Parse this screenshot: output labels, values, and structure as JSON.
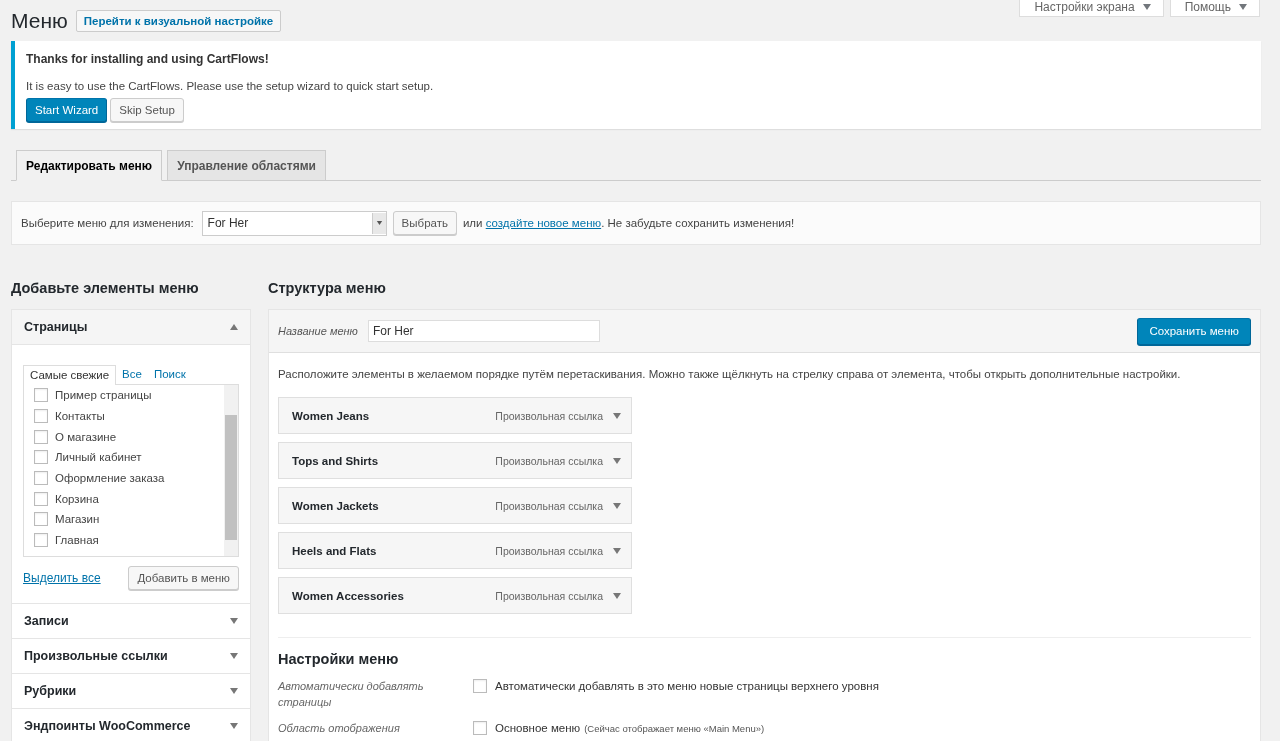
{
  "page": {
    "title": "Меню",
    "action_button": "Перейти к визуальной настройке"
  },
  "screen_meta": [
    {
      "label": "Настройки экрана"
    },
    {
      "label": "Помощь"
    }
  ],
  "notice": {
    "title": "Thanks for installing and using CartFlows!",
    "message": "It is easy to use the CartFlows. Please use the setup wizard to quick start setup.",
    "buttons": [
      {
        "label": "Start Wizard",
        "kind": "primary"
      },
      {
        "label": "Skip Setup",
        "kind": "secondary"
      }
    ]
  },
  "tabs": [
    {
      "label": "Редактировать меню",
      "selected": true
    },
    {
      "label": "Управление областями",
      "selected": false
    }
  ],
  "select_bar": {
    "label": "Выберите меню для изменения:",
    "value": "For Her",
    "button": "Выбрать",
    "text_before_link": "или ",
    "link": "создайте новое меню",
    "text_after_link": ". Не забудьте сохранить изменения!"
  },
  "add_items": {
    "title": "Добавьте элементы меню",
    "sections": [
      {
        "title": "Страницы",
        "expanded": true,
        "tabs": [
          {
            "label": "Самые свежие",
            "selected": true
          },
          {
            "label": "Все",
            "selected": false
          },
          {
            "label": "Поиск",
            "selected": false
          }
        ],
        "items": [
          {
            "label": "Пример страницы",
            "checked": false
          },
          {
            "label": "Контакты",
            "checked": false
          },
          {
            "label": "О магазине",
            "checked": false
          },
          {
            "label": "Личный кабинет",
            "checked": false
          },
          {
            "label": "Оформление заказа",
            "checked": false
          },
          {
            "label": "Корзина",
            "checked": false
          },
          {
            "label": "Магазин",
            "checked": false
          },
          {
            "label": "Главная",
            "checked": false
          }
        ],
        "select_all": "Выделить все",
        "add_button": "Добавить в меню"
      },
      {
        "title": "Записи",
        "expanded": false
      },
      {
        "title": "Произвольные ссылки",
        "expanded": false
      },
      {
        "title": "Рубрики",
        "expanded": false
      },
      {
        "title": "Эндпоинты WooCommerce",
        "expanded": false
      }
    ]
  },
  "structure": {
    "title": "Структура меню",
    "name_label": "Название меню",
    "name_value": "For Her",
    "save_button": "Сохранить меню",
    "instructions": "Расположите элементы в желаемом порядке путём перетаскивания. Можно также щёлкнуть на стрелку справа от элемента, чтобы открыть дополнительные настройки.",
    "items": [
      {
        "title": "Women Jeans",
        "type": "Произвольная ссылка"
      },
      {
        "title": "Tops and Shirts",
        "type": "Произвольная ссылка"
      },
      {
        "title": "Women Jackets",
        "type": "Произвольная ссылка"
      },
      {
        "title": "Heels and Flats",
        "type": "Произвольная ссылка"
      },
      {
        "title": "Women Accessories",
        "type": "Произвольная ссылка"
      }
    ],
    "settings": {
      "title": "Настройки меню",
      "rows": [
        {
          "label": "Автоматически добавлять страницы",
          "options": [
            {
              "label": "Автоматически добавлять в это меню новые страницы верхнего уровня",
              "checked": false
            }
          ]
        },
        {
          "label": "Область отображения",
          "options": [
            {
              "label": "Основное меню",
              "note": "(Сейчас отображает меню «Main Menu»)",
              "checked": false
            }
          ]
        }
      ]
    }
  }
}
